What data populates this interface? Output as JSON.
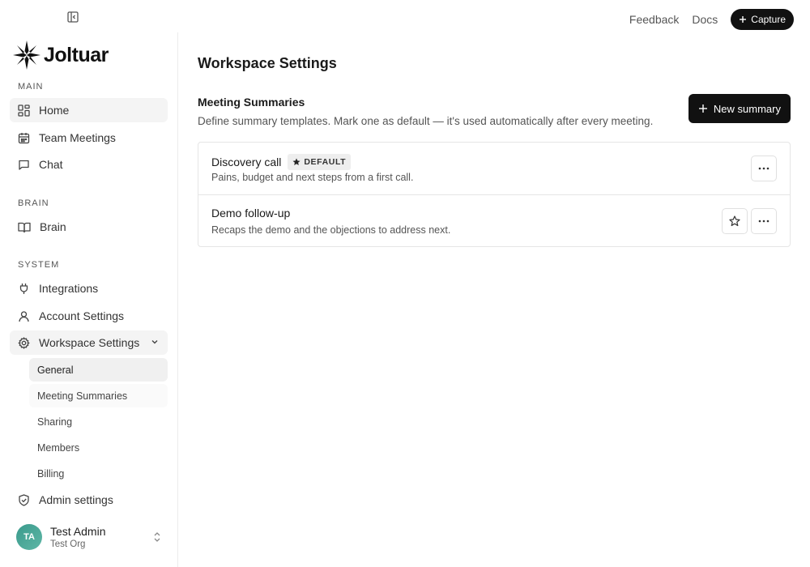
{
  "topbar": {
    "feedback_label": "Feedback",
    "docs_label": "Docs",
    "capture_label": "Capture"
  },
  "sidebar": {
    "logo_text": "Joltuar",
    "sections": {
      "main": "MAIN",
      "brain": "BRAIN",
      "system": "SYSTEM"
    },
    "items": {
      "home": "Home",
      "team_meetings": "Team Meetings",
      "chat": "Chat",
      "brain": "Brain",
      "integrations": "Integrations",
      "account_settings": "Account Settings",
      "workspace_settings": "Workspace Settings",
      "admin_settings": "Admin settings"
    },
    "workspace_sub": {
      "general": "General",
      "meeting_summaries": "Meeting Summaries",
      "sharing": "Sharing",
      "members": "Members",
      "billing": "Billing"
    },
    "user": {
      "initials": "TA",
      "name": "Test Admin",
      "org": "Test Org"
    }
  },
  "main": {
    "page_title": "Workspace Settings",
    "section_title": "Meeting Summaries",
    "section_desc": "Define summary templates. Mark one as default — it's used automatically after every meeting.",
    "new_button_label": "New summary",
    "templates": [
      {
        "name": "Discovery call",
        "badge": "DEFAULT",
        "description": "Pains, budget and next steps from a first call."
      },
      {
        "name": "Demo follow-up",
        "badge": "",
        "description": "Recaps the demo and the objections to address next."
      }
    ]
  },
  "colors": {
    "primary_button": "#111111",
    "avatar_teal": "#3a9a8c"
  }
}
